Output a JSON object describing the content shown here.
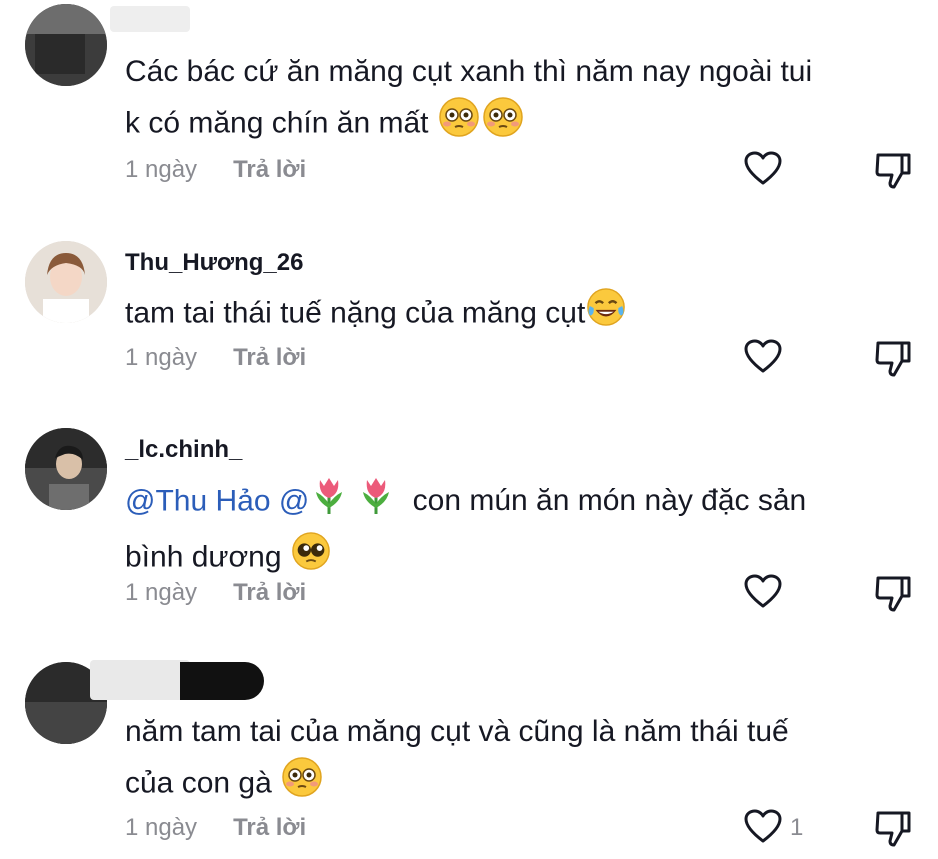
{
  "comments": [
    {
      "username": "",
      "text": "Các bác cứ ăn măng cụt xanh thì năm nay ngoài tui",
      "text2": "k có măng chín ăn mất",
      "time": "1 ngày",
      "reply": "Trả lời",
      "likes": ""
    },
    {
      "username": "Thu_Hương_26",
      "text": "tam tai thái tuế nặng của măng cụt",
      "time": "1 ngày",
      "reply": "Trả lời",
      "likes": ""
    },
    {
      "username": "_lc.chinh_",
      "mention": "@Thu Hảo @",
      "text": "con mún ăn món này đặc sản",
      "text2": "bình dương",
      "time": "1 ngày",
      "reply": "Trả lời",
      "likes": ""
    },
    {
      "username": "",
      "text": "năm tam tai của măng cụt và cũng là năm thái tuế",
      "text2": "của con gà",
      "time": "1 ngày",
      "reply": "Trả lời",
      "likes": "1"
    }
  ],
  "icons": {
    "like": "heart-outline-icon",
    "dislike": "thumbs-down-icon"
  },
  "colors": {
    "text": "#161823",
    "meta": "#8a8b91",
    "mention": "#2b5db9"
  }
}
